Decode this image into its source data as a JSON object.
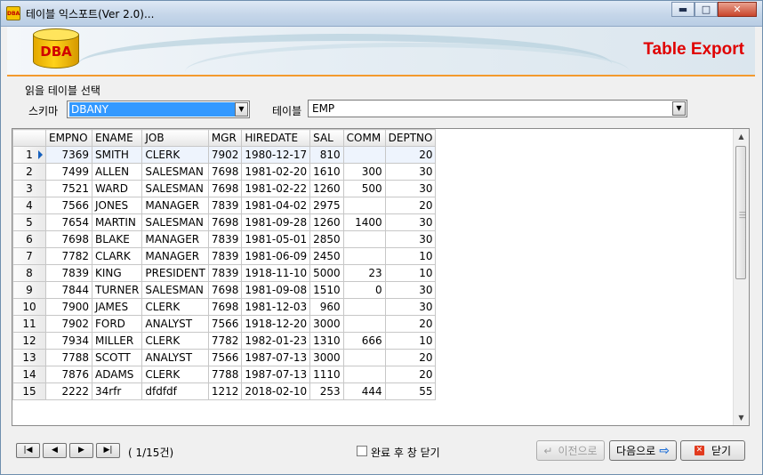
{
  "window": {
    "title": "테이블 익스포트(Ver 2.0)...",
    "app_icon": "DBA",
    "controls": {
      "minimize": "▬",
      "maximize": "□",
      "close": "✕"
    }
  },
  "banner": {
    "logo_text": "DBA",
    "heading": "Table Export"
  },
  "selector": {
    "group_label": "읽을 테이블 선택",
    "schema_label": "스키마",
    "schema_value": "DBANY",
    "table_label": "테이블",
    "table_value": "EMP"
  },
  "grid": {
    "columns": [
      "EMPNO",
      "ENAME",
      "JOB",
      "MGR",
      "HIREDATE",
      "SAL",
      "COMM",
      "DEPTNO"
    ],
    "rows": [
      [
        "1",
        "7369",
        "SMITH",
        "CLERK",
        "7902",
        "1980-12-17",
        "810",
        "",
        "20"
      ],
      [
        "2",
        "7499",
        "ALLEN",
        "SALESMAN",
        "7698",
        "1981-02-20",
        "1610",
        "300",
        "30"
      ],
      [
        "3",
        "7521",
        "WARD",
        "SALESMAN",
        "7698",
        "1981-02-22",
        "1260",
        "500",
        "30"
      ],
      [
        "4",
        "7566",
        "JONES",
        "MANAGER",
        "7839",
        "1981-04-02",
        "2975",
        "",
        "20"
      ],
      [
        "5",
        "7654",
        "MARTIN",
        "SALESMAN",
        "7698",
        "1981-09-28",
        "1260",
        "1400",
        "30"
      ],
      [
        "6",
        "7698",
        "BLAKE",
        "MANAGER",
        "7839",
        "1981-05-01",
        "2850",
        "",
        "30"
      ],
      [
        "7",
        "7782",
        "CLARK",
        "MANAGER",
        "7839",
        "1981-06-09",
        "2450",
        "",
        "10"
      ],
      [
        "8",
        "7839",
        "KING",
        "PRESIDENT",
        "7839",
        "1918-11-10",
        "5000",
        "23",
        "10"
      ],
      [
        "9",
        "7844",
        "TURNER",
        "SALESMAN",
        "7698",
        "1981-09-08",
        "1510",
        "0",
        "30"
      ],
      [
        "10",
        "7900",
        "JAMES",
        "CLERK",
        "7698",
        "1981-12-03",
        "960",
        "",
        "30"
      ],
      [
        "11",
        "7902",
        "FORD",
        "ANALYST",
        "7566",
        "1918-12-20",
        "3000",
        "",
        "20"
      ],
      [
        "12",
        "7934",
        "MILLER",
        "CLERK",
        "7782",
        "1982-01-23",
        "1310",
        "666",
        "10"
      ],
      [
        "13",
        "7788",
        "SCOTT",
        "ANALYST",
        "7566",
        "1987-07-13",
        "3000",
        "",
        "20"
      ],
      [
        "14",
        "7876",
        "ADAMS",
        "CLERK",
        "7788",
        "1987-07-13",
        "1110",
        "",
        "20"
      ],
      [
        "15",
        "2222",
        "34rfr",
        "dfdfdf",
        "1212",
        "2018-02-10",
        "253",
        "444",
        "55"
      ]
    ]
  },
  "navigator": {
    "first": "|◀",
    "prev": "◀",
    "next": "▶",
    "last": "▶|",
    "count": "( 1/15건)"
  },
  "footer": {
    "close_after_label": "완료 후 창 닫기",
    "prev_label": "이전으로",
    "next_label": "다음으로",
    "close_label": "닫기"
  }
}
